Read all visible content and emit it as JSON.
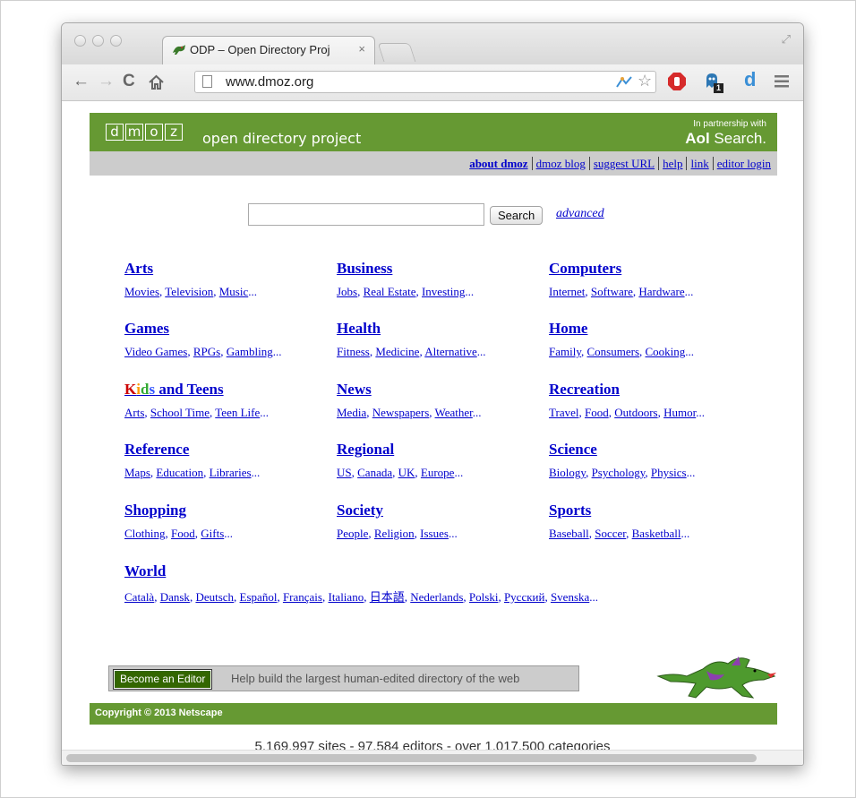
{
  "browser": {
    "tab_title": "ODP – Open Directory Proj",
    "tab_close": "×",
    "url": "www.dmoz.org",
    "extension_badge": "1"
  },
  "header": {
    "logo_letters": [
      "d",
      "m",
      "o",
      "z"
    ],
    "tagline": "open directory project",
    "partner_small": "In partnership with",
    "partner_brand": "Aol",
    "partner_rest": "Search."
  },
  "linkbar": [
    "about dmoz",
    "dmoz blog",
    "suggest URL",
    "help",
    "link",
    "editor login"
  ],
  "search": {
    "value": "",
    "button": "Search",
    "advanced": "advanced"
  },
  "categories": [
    {
      "title": "Arts",
      "subs": [
        "Movies",
        "Television",
        "Music"
      ]
    },
    {
      "title": "Business",
      "subs": [
        "Jobs",
        "Real Estate",
        "Investing"
      ]
    },
    {
      "title": "Computers",
      "subs": [
        "Internet",
        "Software",
        "Hardware"
      ]
    },
    {
      "title": "Games",
      "subs": [
        "Video Games",
        "RPGs",
        "Gambling"
      ]
    },
    {
      "title": "Health",
      "subs": [
        "Fitness",
        "Medicine",
        "Alternative"
      ]
    },
    {
      "title": "Home",
      "subs": [
        "Family",
        "Consumers",
        "Cooking"
      ]
    },
    {
      "title": "Kids and Teens",
      "subs": [
        "Arts",
        "School Time",
        "Teen Life"
      ]
    },
    {
      "title": "News",
      "subs": [
        "Media",
        "Newspapers",
        "Weather"
      ]
    },
    {
      "title": "Recreation",
      "subs": [
        "Travel",
        "Food",
        "Outdoors",
        "Humor"
      ]
    },
    {
      "title": "Reference",
      "subs": [
        "Maps",
        "Education",
        "Libraries"
      ]
    },
    {
      "title": "Regional",
      "subs": [
        "US",
        "Canada",
        "UK",
        "Europe"
      ]
    },
    {
      "title": "Science",
      "subs": [
        "Biology",
        "Psychology",
        "Physics"
      ]
    },
    {
      "title": "Shopping",
      "subs": [
        "Clothing",
        "Food",
        "Gifts"
      ]
    },
    {
      "title": "Society",
      "subs": [
        "People",
        "Religion",
        "Issues"
      ]
    },
    {
      "title": "Sports",
      "subs": [
        "Baseball",
        "Soccer",
        "Basketball"
      ]
    },
    {
      "title": "World",
      "subs": [
        "Català",
        "Dansk",
        "Deutsch",
        "Español",
        "Français",
        "Italiano",
        "日本語",
        "Nederlands",
        "Polski",
        "Русский",
        "Svenska"
      ]
    }
  ],
  "kids_title": {
    "k": "K",
    "i": "i",
    "d": "d",
    "s": "s",
    "rest": " and Teens"
  },
  "editor": {
    "button": "Become an Editor",
    "text": "Help build the largest human-edited directory of the web"
  },
  "footer": {
    "copyright": "Copyright © 2013 Netscape"
  },
  "stats": "5,169,997 sites - 97,584 editors - over 1,017,500 categories",
  "colors": {
    "brand_green": "#669933",
    "link_blue": "#0000cc",
    "linkbar_grey": "#cccccc"
  },
  "icons": [
    "back-icon",
    "forward-icon",
    "reload-icon",
    "home-icon",
    "page-icon",
    "tracking-icon",
    "star-icon",
    "stop-extension-icon",
    "ghostery-icon",
    "d-extension-icon",
    "menu-icon",
    "dragon-mascot"
  ]
}
